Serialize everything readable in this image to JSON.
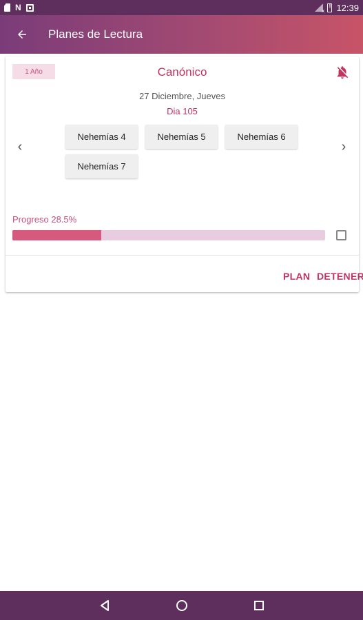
{
  "status_bar": {
    "time": "12:39"
  },
  "app_bar": {
    "title": "Planes de Lectura"
  },
  "plan_card": {
    "badge": "1 Año",
    "plan_name": "Canónico",
    "date": "27 Diciembre, Jueves",
    "day": "Dia 105",
    "prev_arrow": "‹",
    "next_arrow": "›",
    "chapters": [
      "Nehemías 4",
      "Nehemías 5",
      "Nehemías 6",
      "Nehemías 7"
    ],
    "progress_label": "Progreso 28.5%",
    "progress_fraction": 0.285,
    "completed_checkbox_checked": false,
    "actions": {
      "plan": "PLAN",
      "stop": "DETENER"
    }
  },
  "icons": {
    "back": "arrow-back-icon",
    "bell": "notifications-off-icon",
    "nav_back": "triangle-back-icon",
    "nav_home": "circle-home-icon",
    "nav_recent": "square-recents-icon"
  },
  "colors": {
    "status_bar": "#5e2f5c",
    "app_bar_start": "#7a3c79",
    "app_bar_end": "#c75467",
    "accent": "#c2335f",
    "progress_fill": "#d65a7e",
    "progress_track": "#e8cde0",
    "badge_bg": "#f6dce6"
  }
}
